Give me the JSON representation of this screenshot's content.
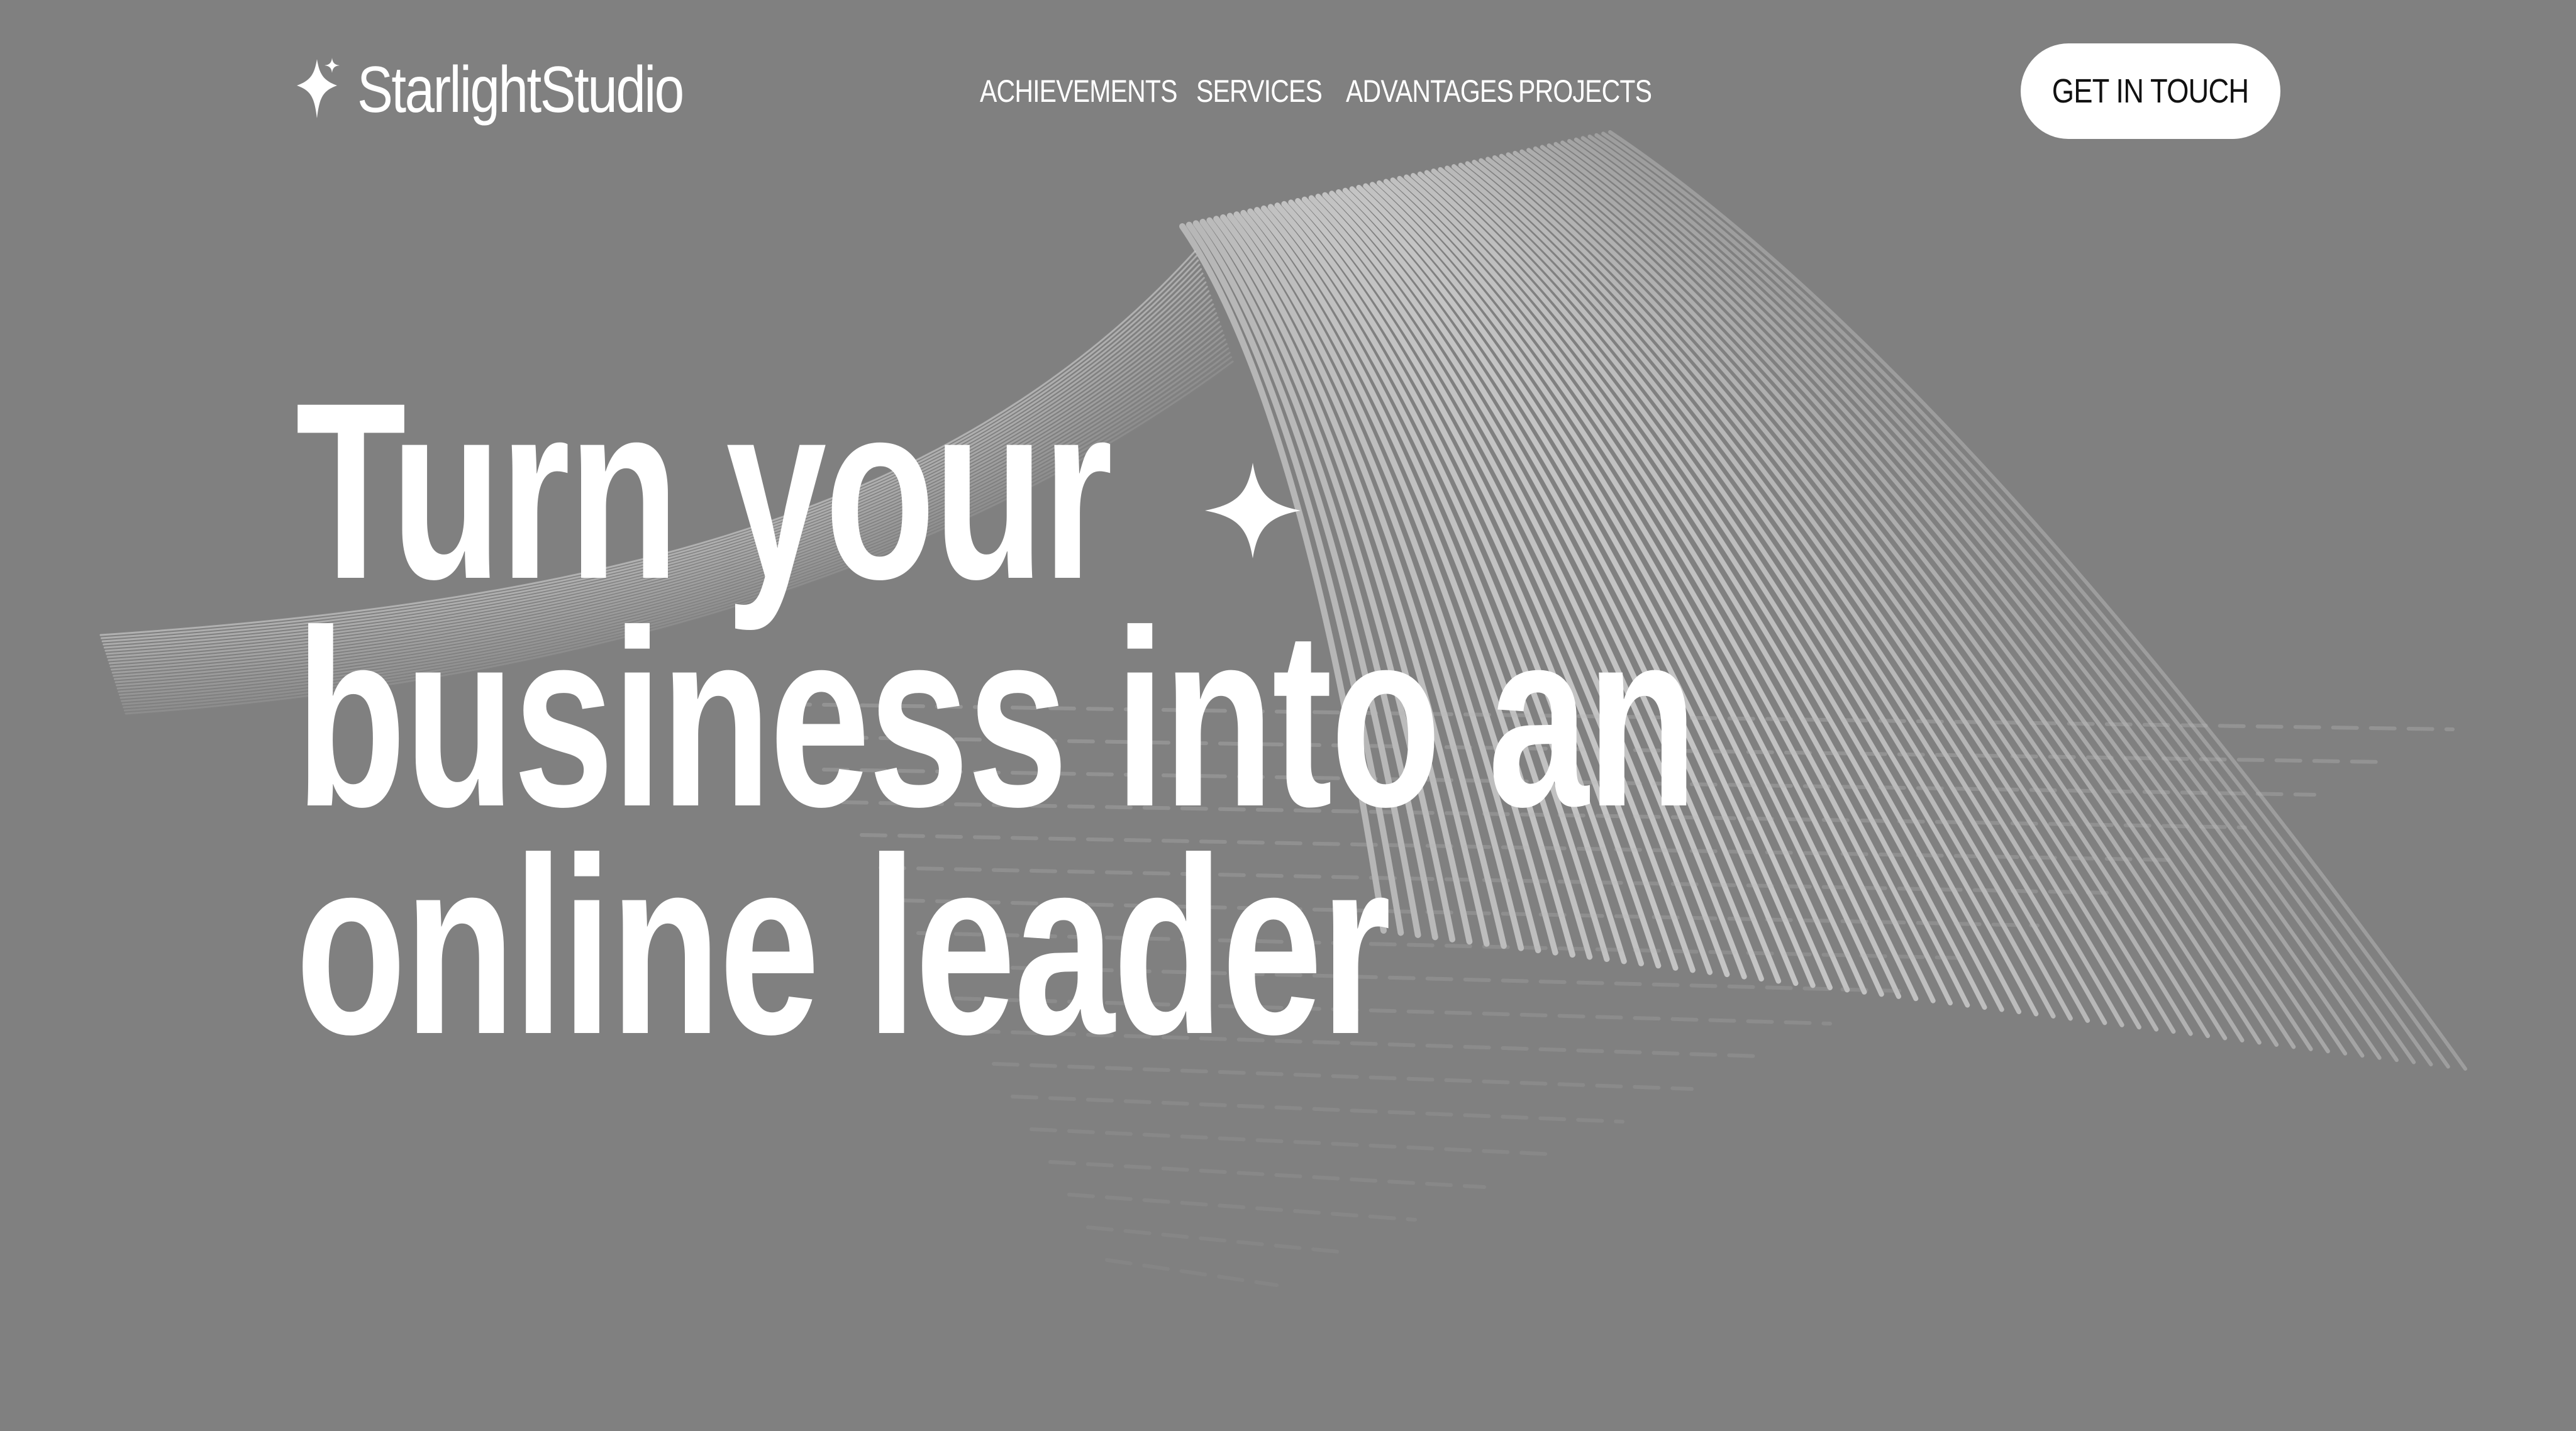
{
  "brand": {
    "name": "StarlightStudio",
    "logo_icon": "four-point-star-icon"
  },
  "nav": {
    "items": [
      {
        "label": "ACHIEVEMENTS"
      },
      {
        "label": "SERVICES"
      },
      {
        "label": "ADVANTAGES"
      },
      {
        "label": "PROJECTS"
      }
    ]
  },
  "cta": {
    "label": "GET IN TOUCH"
  },
  "hero": {
    "title_lines": [
      "Turn your",
      "business into an",
      "online leader"
    ],
    "sparkle_icon": "four-point-star-icon",
    "background_art": "abstract-wave-lines"
  },
  "colors": {
    "background": "#808080",
    "text": "#ffffff",
    "button_bg": "#ffffff",
    "button_text": "#111111"
  }
}
